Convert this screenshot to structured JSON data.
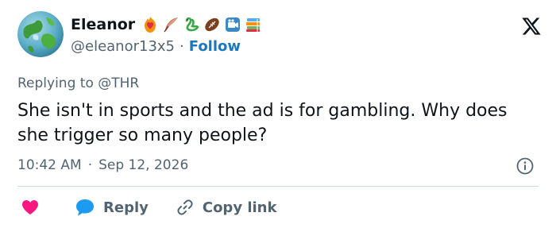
{
  "user": {
    "display_name": "Eleanor",
    "handle": "@eleanor13x5",
    "follow_label": "Follow",
    "badge_icons": [
      "heart-on-fire-icon",
      "feather-icon",
      "swan-icon",
      "football-icon",
      "camera-icon",
      "books-icon"
    ]
  },
  "tweet": {
    "replying_prefix": "Replying to",
    "replying_to": "@THR",
    "text": "She isn't in sports and the ad is for gambling. Why does she trigger so many people?",
    "time": "10:42 AM",
    "date": "Sep 12, 2026"
  },
  "actions": {
    "reply_label": "Reply",
    "copy_link_label": "Copy link"
  },
  "colors": {
    "follow": "#1d77c0",
    "heart": "#f91880",
    "reply_bubble": "#1d9bf0",
    "muted": "#536471"
  }
}
